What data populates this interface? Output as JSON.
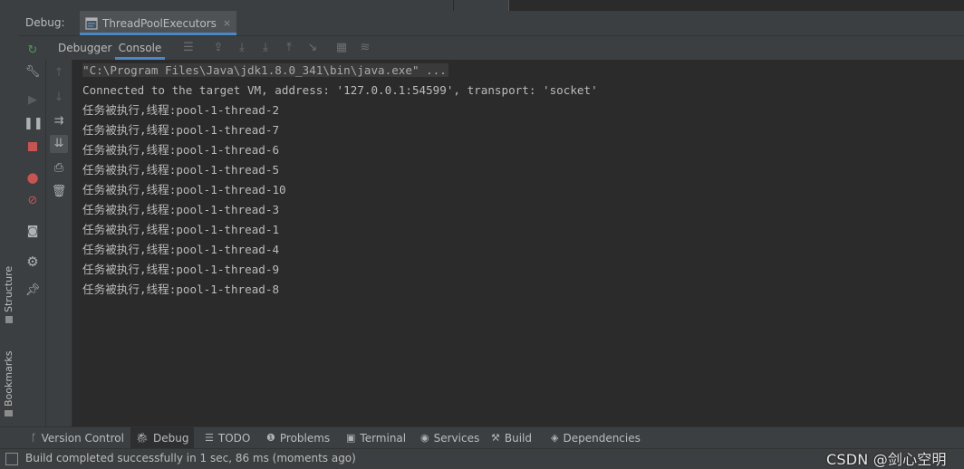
{
  "debug_header": {
    "label": "Debug:",
    "tab_title": "ThreadPoolExecutors",
    "tab_close": "×"
  },
  "sub_tabs": {
    "debugger": "Debugger",
    "console": "Console"
  },
  "left_stripe": {
    "structure": "Structure",
    "bookmarks": "Bookmarks"
  },
  "console": {
    "command": "\"C:\\Program Files\\Java\\jdk1.8.0_341\\bin\\java.exe\" ...",
    "connected": "Connected to the target VM, address: '127.0.0.1:54599', transport: 'socket'",
    "lines": [
      "任务被执行,线程:pool-1-thread-2",
      "任务被执行,线程:pool-1-thread-7",
      "任务被执行,线程:pool-1-thread-6",
      "任务被执行,线程:pool-1-thread-5",
      "任务被执行,线程:pool-1-thread-10",
      "任务被执行,线程:pool-1-thread-3",
      "任务被执行,线程:pool-1-thread-1",
      "任务被执行,线程:pool-1-thread-4",
      "任务被执行,线程:pool-1-thread-9",
      "任务被执行,线程:pool-1-thread-8"
    ]
  },
  "bottom_tools": {
    "version_control": "Version Control",
    "debug": "Debug",
    "todo": "TODO",
    "problems": "Problems",
    "terminal": "Terminal",
    "services": "Services",
    "build": "Build",
    "dependencies": "Dependencies"
  },
  "status": {
    "text": "Build completed successfully in 1 sec, 86 ms (moments ago)",
    "watermark": "CSDN @剑心空明"
  },
  "colors": {
    "background": "#2b2b2b",
    "panel": "#3c3f41",
    "accent": "#4a88c7",
    "rerun_green": "#499c54",
    "stop_red": "#c75450"
  },
  "icons": [
    "rerun-icon",
    "settings-wrench-icon",
    "resume-icon",
    "pause-icon",
    "stop-icon",
    "view-breakpoints-icon",
    "mute-breakpoints-icon",
    "camera-icon",
    "gear-icon",
    "pin-icon",
    "up-arrow-icon",
    "down-arrow-icon",
    "soft-wrap-icon",
    "scroll-to-end-icon",
    "print-icon",
    "trash-icon"
  ]
}
